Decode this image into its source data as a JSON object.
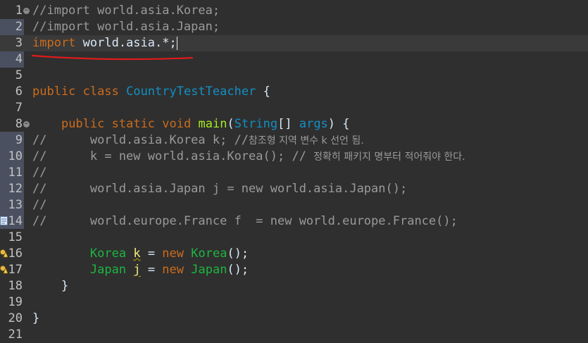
{
  "editor": {
    "lines": [
      {
        "n": "1",
        "fold": true,
        "tokens": [
          {
            "t": "comment",
            "v": "//import world.asia.Korea;"
          }
        ]
      },
      {
        "n": "2",
        "tokens": [
          {
            "t": "comment",
            "v": "//import world.asia.Japan;"
          }
        ]
      },
      {
        "n": "3",
        "current": true,
        "caret": true,
        "tokens": [
          {
            "t": "kw",
            "v": "import"
          },
          {
            "t": "plain",
            "v": " world.asia.*;"
          }
        ]
      },
      {
        "n": "4",
        "tokens": []
      },
      {
        "n": "5",
        "tokens": []
      },
      {
        "n": "6",
        "tokens": [
          {
            "t": "kw",
            "v": "public"
          },
          {
            "t": "plain",
            "v": " "
          },
          {
            "t": "kw",
            "v": "class"
          },
          {
            "t": "plain",
            "v": " "
          },
          {
            "t": "type",
            "v": "CountryTestTeacher"
          },
          {
            "t": "plain",
            "v": " {"
          }
        ]
      },
      {
        "n": "7",
        "tokens": []
      },
      {
        "n": "8",
        "fold": true,
        "tokens": [
          {
            "t": "plain",
            "v": "    "
          },
          {
            "t": "kw",
            "v": "public"
          },
          {
            "t": "plain",
            "v": " "
          },
          {
            "t": "kw",
            "v": "static"
          },
          {
            "t": "plain",
            "v": " "
          },
          {
            "t": "kw",
            "v": "void"
          },
          {
            "t": "plain",
            "v": " "
          },
          {
            "t": "method",
            "v": "main"
          },
          {
            "t": "plain",
            "v": "("
          },
          {
            "t": "type",
            "v": "String"
          },
          {
            "t": "plain",
            "v": "[] "
          },
          {
            "t": "type",
            "v": "args"
          },
          {
            "t": "plain",
            "v": ") {"
          }
        ]
      },
      {
        "n": "9",
        "tokens": [
          {
            "t": "comment",
            "v": "//      world.asia.Korea k; //"
          },
          {
            "t": "comment hangul",
            "v": "참조형 지역 변수 k 선언 됨."
          }
        ]
      },
      {
        "n": "10",
        "tokens": [
          {
            "t": "comment",
            "v": "//      k = new world.asia.Korea(); // "
          },
          {
            "t": "comment hangul",
            "v": "정확히 패키지 명부터 적어줘야 한다."
          }
        ]
      },
      {
        "n": "11",
        "tokens": [
          {
            "t": "comment",
            "v": "//"
          }
        ]
      },
      {
        "n": "12",
        "tokens": [
          {
            "t": "comment",
            "v": "//      world.asia.Japan j = new world.asia.Japan();"
          }
        ]
      },
      {
        "n": "13",
        "tokens": [
          {
            "t": "comment",
            "v": "//"
          }
        ]
      },
      {
        "n": "14",
        "marker": "task",
        "tokens": [
          {
            "t": "comment",
            "v": "//      world.europe.France f  = new world.europe.France();"
          }
        ]
      },
      {
        "n": "15",
        "tokens": []
      },
      {
        "n": "16",
        "marker": "warning",
        "tokens": [
          {
            "t": "plain",
            "v": "        "
          },
          {
            "t": "class-name",
            "v": "Korea"
          },
          {
            "t": "plain",
            "v": " "
          },
          {
            "t": "var-warn",
            "v": "k"
          },
          {
            "t": "plain",
            "v": " = "
          },
          {
            "t": "kw",
            "v": "new"
          },
          {
            "t": "plain",
            "v": " "
          },
          {
            "t": "class-name",
            "v": "Korea"
          },
          {
            "t": "plain",
            "v": "();"
          }
        ]
      },
      {
        "n": "17",
        "marker": "warning",
        "tokens": [
          {
            "t": "plain",
            "v": "        "
          },
          {
            "t": "class-name",
            "v": "Japan"
          },
          {
            "t": "plain",
            "v": " "
          },
          {
            "t": "var-warn",
            "v": "j"
          },
          {
            "t": "plain",
            "v": " = "
          },
          {
            "t": "kw",
            "v": "new"
          },
          {
            "t": "plain",
            "v": " "
          },
          {
            "t": "class-name",
            "v": "Japan"
          },
          {
            "t": "plain",
            "v": "();"
          }
        ]
      },
      {
        "n": "18",
        "tokens": [
          {
            "t": "plain",
            "v": "    }"
          }
        ]
      },
      {
        "n": "19",
        "tokens": []
      },
      {
        "n": "20",
        "tokens": [
          {
            "t": "plain",
            "v": "}"
          }
        ]
      },
      {
        "n": "21",
        "tokens": []
      }
    ]
  },
  "icons": {
    "fold": "fold-toggle-icon",
    "task": "task-marker-icon",
    "warning": "warning-marker-icon",
    "annotation": "red-underline-annotation"
  },
  "colors": {
    "background": "#2f2f2f",
    "current_line": "#3a3a3a",
    "keyword": "#cc6c1d",
    "type": "#1290c3",
    "method": "#a7ec21",
    "class_name": "#1eb540",
    "comment": "#9a9a9a",
    "warning_var": "#f3ec79",
    "annotation_red": "#e01b1b"
  }
}
